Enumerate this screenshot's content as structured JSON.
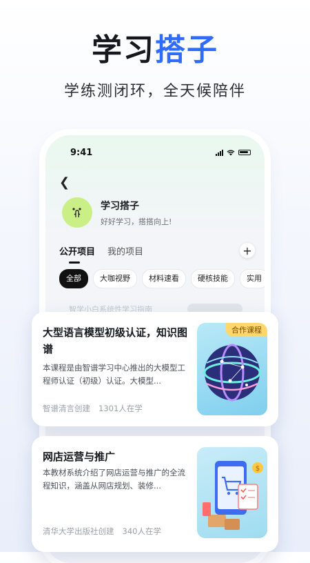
{
  "hero": {
    "title_part1": "学习",
    "title_part2": "搭子",
    "subtitle": "学练测闭环，全天候陪伴"
  },
  "phone": {
    "status_time": "9:41",
    "profile": {
      "name": "学习搭子",
      "bio": "好好学习，搭搭向上!"
    },
    "tabs": [
      {
        "label": "公开项目",
        "active": true
      },
      {
        "label": "我的项目",
        "active": false
      }
    ],
    "filters": [
      {
        "label": "全部",
        "active": true
      },
      {
        "label": "大咖视野"
      },
      {
        "label": "材料速看"
      },
      {
        "label": "硬核技能"
      },
      {
        "label": "实用"
      }
    ],
    "faded_row_text": "智学小白系统性学习指南"
  },
  "courses": [
    {
      "title": "大型语言模型初级认证，知识图谱",
      "description": "本课程是由智谱学习中心推出的大模型工程师认证（初级）认证。大模型...",
      "creator": "智谱清言创建",
      "learners": "1301人在学",
      "badge": "合作课程",
      "image_icon": "globe-network-icon"
    },
    {
      "title": "网店运营与推广",
      "description": "本教材系统介绍了网店运营与推广的全流程知识，涵盖从网店规划、装修...",
      "creator": "清华大学出版社创建",
      "learners": "340人在学",
      "image_icon": "ecommerce-icon"
    }
  ],
  "colors": {
    "accent_blue": "#2f6bff",
    "avatar_green": "#c9ef86",
    "badge_yellow": "#ffd76a"
  }
}
